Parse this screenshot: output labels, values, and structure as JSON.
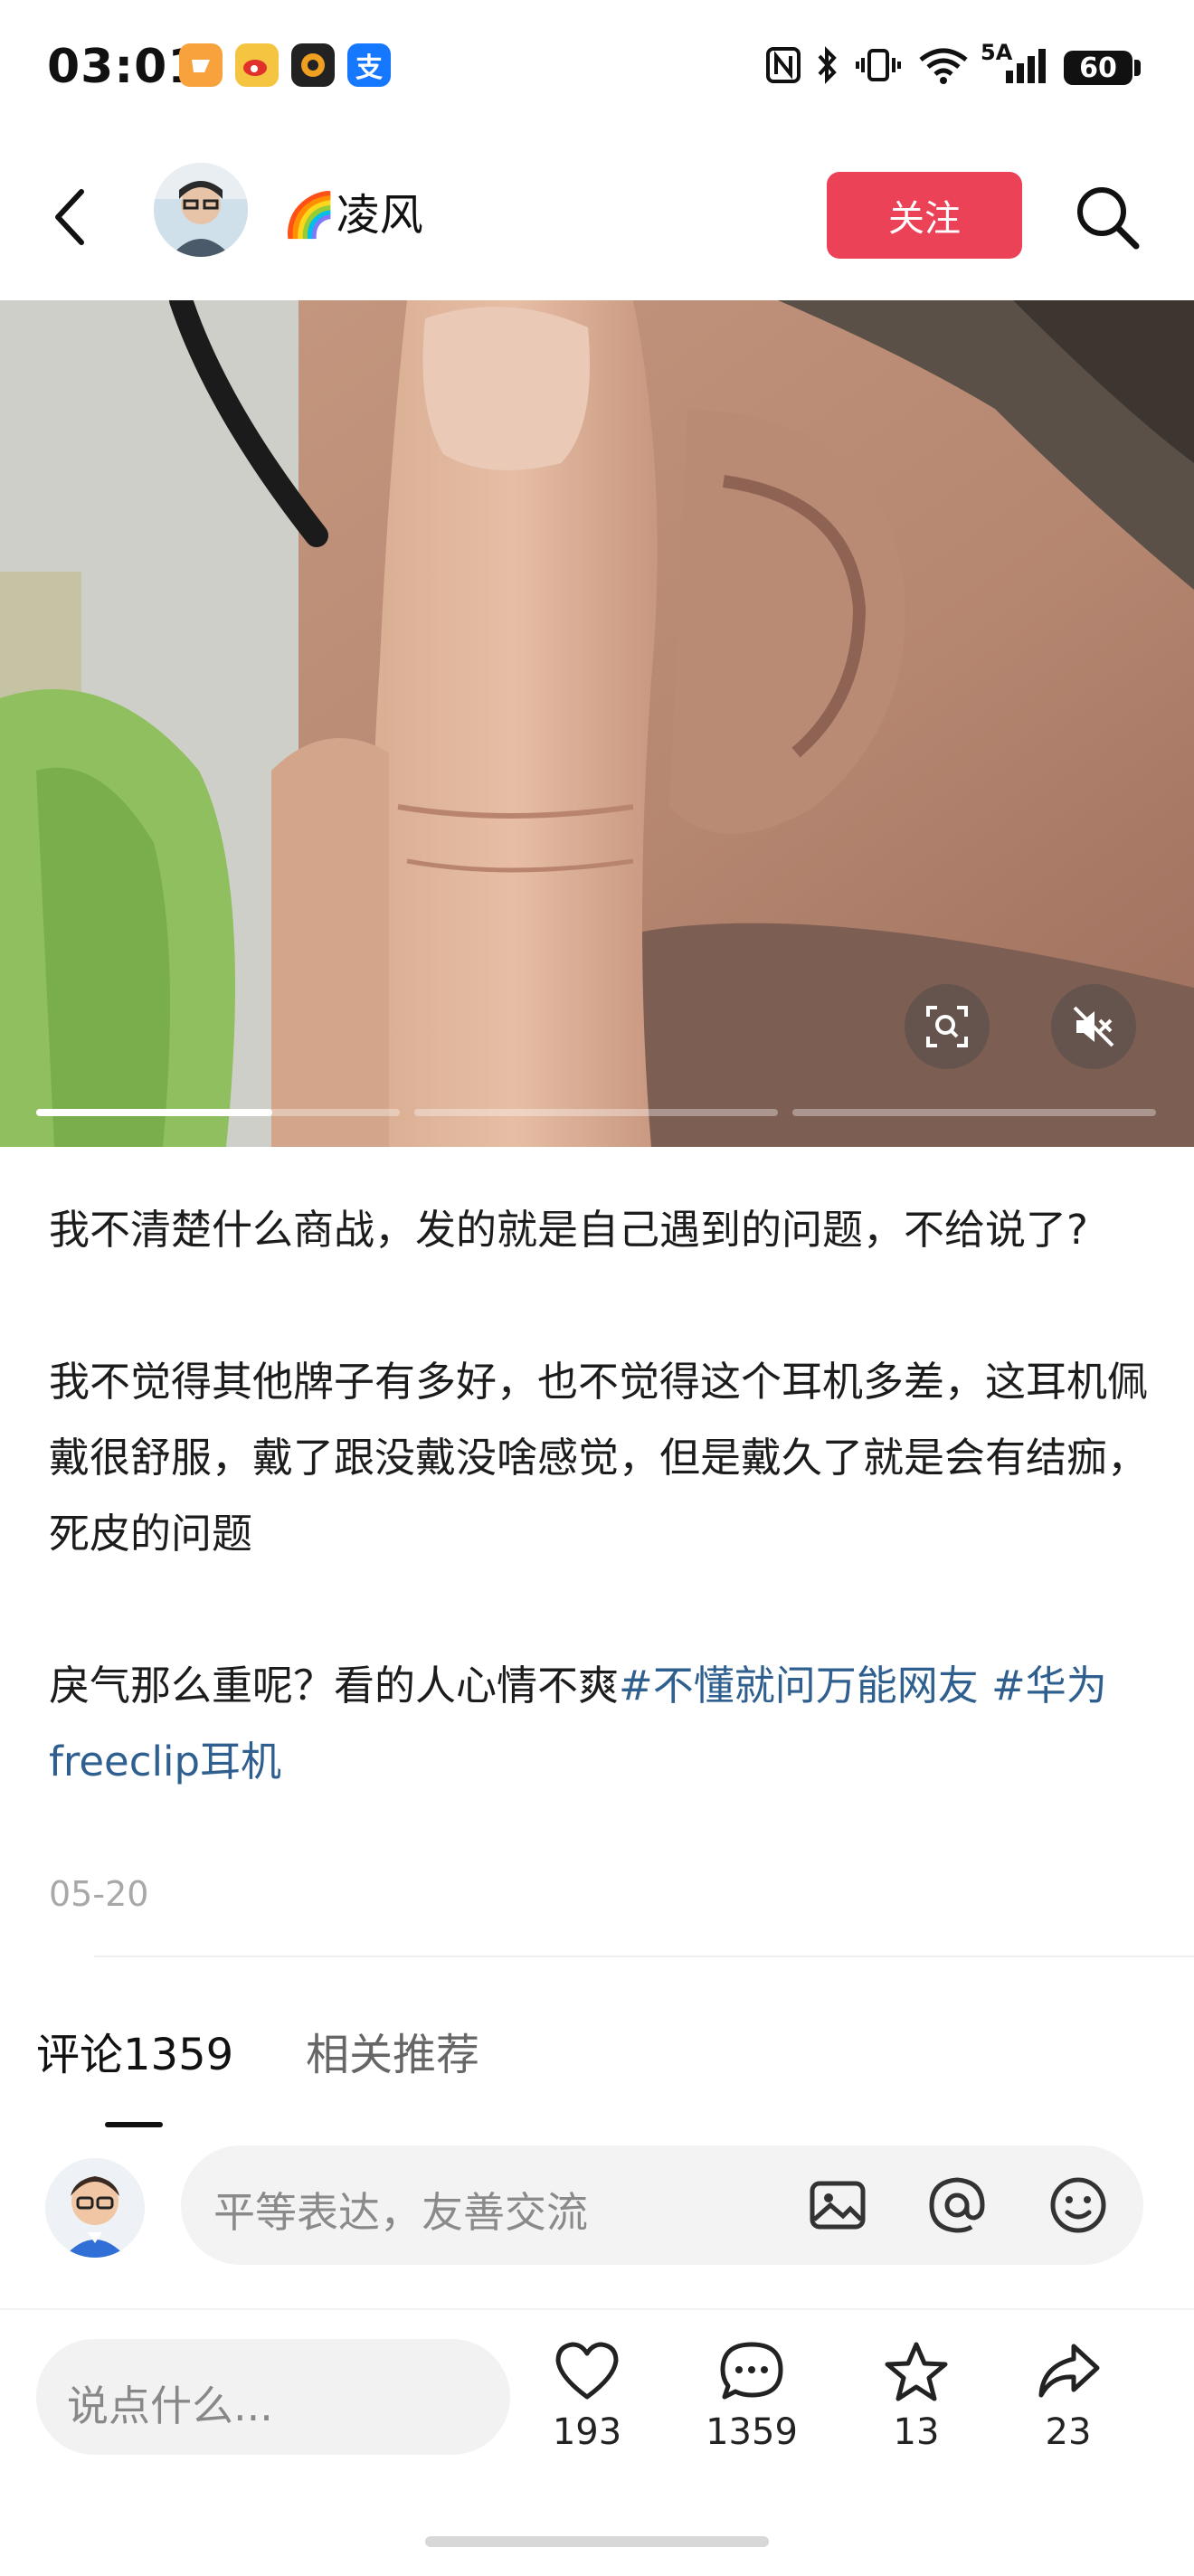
{
  "status_bar": {
    "time": "03:01",
    "network": "5A",
    "battery": "60",
    "app_icons": [
      {
        "name": "taobao-icon",
        "color": "#f7a23c"
      },
      {
        "name": "weibo-icon",
        "color": "#f5c542"
      },
      {
        "name": "app-icon",
        "color": "#222222"
      },
      {
        "name": "alipay-icon",
        "color": "#1677ff",
        "glyph": "支"
      }
    ]
  },
  "header": {
    "author_name": "🌈凌风",
    "follow_label": "关注"
  },
  "colors": {
    "accent": "#ec4257",
    "hashtag": "#2f5f8f"
  },
  "post": {
    "paragraph1": "我不清楚什么商战，发的就是自己遇到的问题，不给说了?",
    "paragraph2": "我不觉得其他牌子有多好，也不觉得这个耳机多差，这耳机佩戴很舒服，戴了跟没戴没啥感觉，但是戴久了就是会有结痂，死皮的问题",
    "paragraph3_text": "戾气那么重呢？看的人心情不爽",
    "hashtag1": "#不懂就问万能网友",
    "hashtag2": "#华为freeclip耳机",
    "date": "05-20"
  },
  "tabs": {
    "comments": "评论1359",
    "related": "相关推荐"
  },
  "comment_input": {
    "placeholder": "平等表达，友善交流",
    "icons": [
      "image-icon",
      "at-icon",
      "emoji-icon"
    ]
  },
  "bottom_bar": {
    "say_placeholder": "说点什么...",
    "likes": "193",
    "comments": "1359",
    "favorites": "13",
    "shares": "23"
  },
  "media": {
    "slides": 3,
    "current_slide_progress": 0.65
  }
}
